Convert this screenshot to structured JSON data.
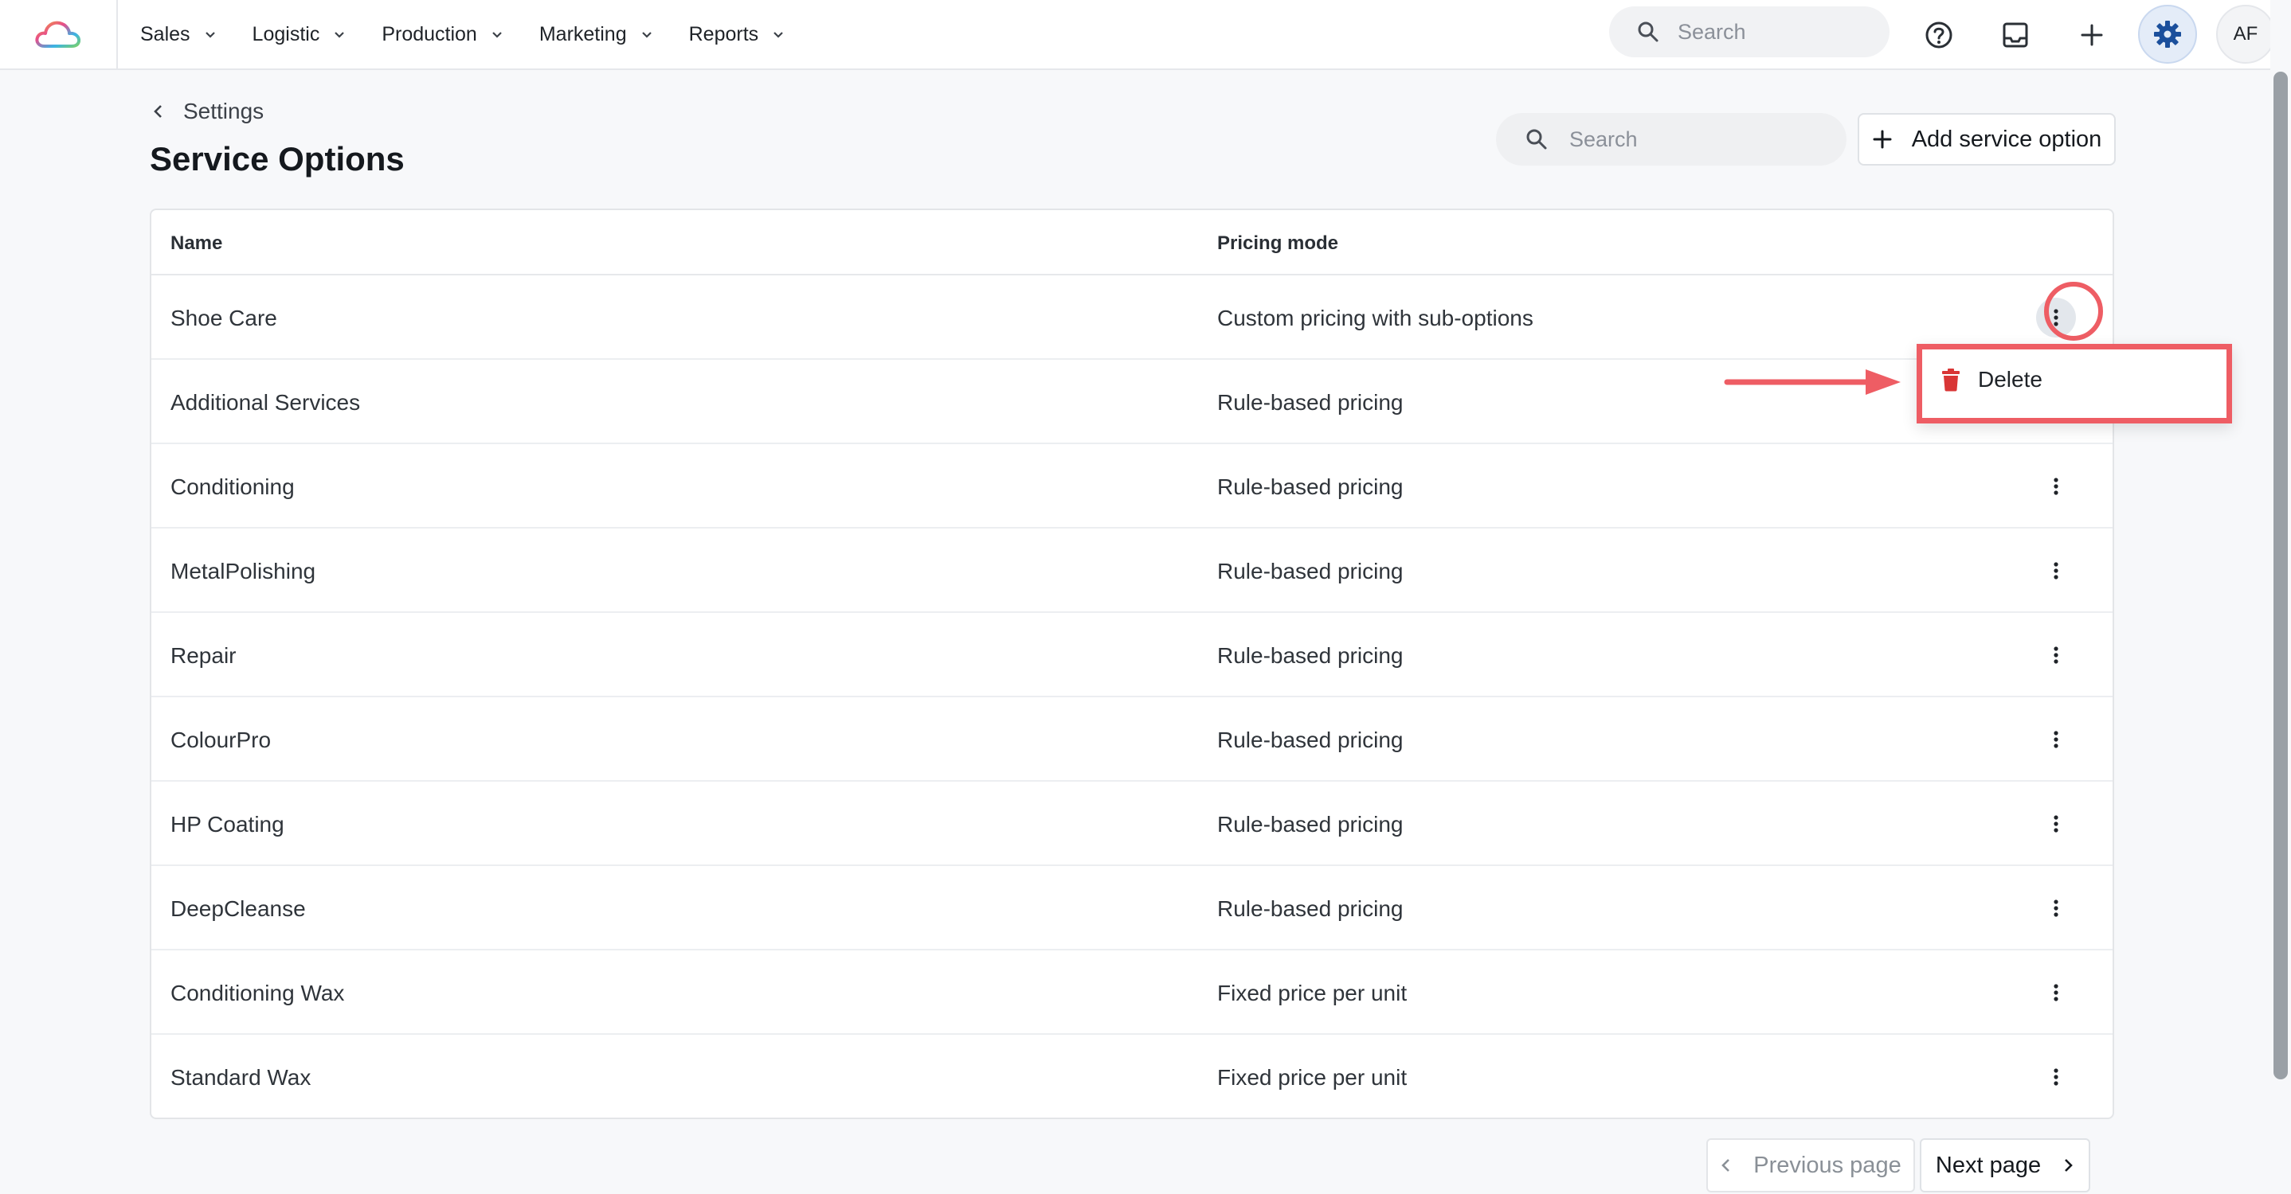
{
  "nav": {
    "items": [
      {
        "label": "Sales"
      },
      {
        "label": "Logistic"
      },
      {
        "label": "Production"
      },
      {
        "label": "Marketing"
      },
      {
        "label": "Reports"
      }
    ],
    "search_placeholder": "Search",
    "avatar_initials": "AF"
  },
  "header": {
    "breadcrumb": "Settings",
    "title": "Service Options",
    "search_placeholder": "Search",
    "add_button_label": "Add service option"
  },
  "table": {
    "columns": [
      "Name",
      "Pricing mode"
    ],
    "rows": [
      {
        "name": "Shoe Care",
        "mode": "Custom pricing with sub-options"
      },
      {
        "name": "Additional Services",
        "mode": "Rule-based pricing"
      },
      {
        "name": "Conditioning",
        "mode": "Rule-based pricing"
      },
      {
        "name": "MetalPolishing",
        "mode": "Rule-based pricing"
      },
      {
        "name": "Repair",
        "mode": "Rule-based pricing"
      },
      {
        "name": "ColourPro",
        "mode": "Rule-based pricing"
      },
      {
        "name": "HP Coating",
        "mode": "Rule-based pricing"
      },
      {
        "name": "DeepCleanse",
        "mode": "Rule-based pricing"
      },
      {
        "name": "Conditioning Wax",
        "mode": "Fixed price per unit"
      },
      {
        "name": "Standard Wax",
        "mode": "Fixed price per unit"
      }
    ]
  },
  "dropdown": {
    "delete_label": "Delete"
  },
  "pagination": {
    "previous_label": "Previous page",
    "next_label": "Next page"
  },
  "colors": {
    "accent": "#ee5d64",
    "danger": "#d93636",
    "gear": "#1b4f9c"
  }
}
